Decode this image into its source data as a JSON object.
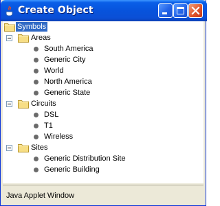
{
  "window": {
    "title": "Create Object"
  },
  "tree": {
    "root": {
      "label": "Symbols",
      "selected": true
    },
    "groups": [
      {
        "label": "Areas",
        "items": [
          "South America",
          "Generic City",
          "World",
          "North America",
          "Generic State"
        ]
      },
      {
        "label": "Circuits",
        "items": [
          "DSL",
          "T1",
          "Wireless"
        ]
      },
      {
        "label": "Sites",
        "items": [
          "Generic Distribution Site",
          "Generic Building"
        ]
      }
    ]
  },
  "status": {
    "text": "Java Applet Window"
  },
  "icons": {
    "app": "java-icon",
    "folder": "folder-icon",
    "toggle": "minus-icon",
    "leaf": "bullet-icon"
  },
  "colors": {
    "selection": "#316ac5",
    "titlebar": "#0a5fe8"
  }
}
